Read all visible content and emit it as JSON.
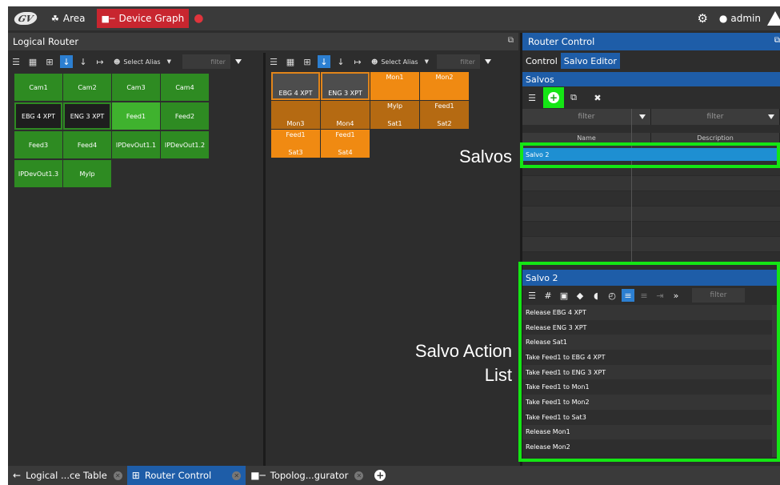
{
  "topbar": {
    "logo_icon": "gv-logo-icon",
    "area_label": "Area",
    "device_graph_label": "Device Graph",
    "user_label": "admin"
  },
  "logical_router": {
    "title": "Logical Router",
    "select_alias_label": "Select Alias",
    "filter_placeholder": "filter",
    "sources": [
      {
        "label": "Cam1",
        "style": "green"
      },
      {
        "label": "Cam2",
        "style": "green"
      },
      {
        "label": "Cam3",
        "style": "green"
      },
      {
        "label": "Cam4",
        "style": "green"
      },
      {
        "label": "EBG 4 XPT",
        "style": "dark"
      },
      {
        "label": "ENG 3 XPT",
        "style": "dark"
      },
      {
        "label": "Feed1",
        "style": "lgreen"
      },
      {
        "label": "Feed2",
        "style": "green"
      },
      {
        "label": "Feed3",
        "style": "green"
      },
      {
        "label": "Feed4",
        "style": "green"
      },
      {
        "label": "IPDevOut1.1",
        "style": "green"
      },
      {
        "label": "IPDevOut1.2",
        "style": "green"
      },
      {
        "label": "IPDevOut1.3",
        "style": "green"
      },
      {
        "label": "MyIp",
        "style": "green"
      }
    ],
    "destinations": [
      {
        "top": "",
        "bottom": "EBG 4 XPT",
        "style": "grey"
      },
      {
        "top": "",
        "bottom": "ENG 3 XPT",
        "style": "grey"
      },
      {
        "top": "Mon1",
        "bottom": "",
        "style": "orange"
      },
      {
        "top": "Mon2",
        "bottom": "",
        "style": "orange"
      },
      {
        "top": "",
        "bottom": "Mon3",
        "style": "dorange"
      },
      {
        "top": "",
        "bottom": "Mon4",
        "style": "dorange"
      },
      {
        "top": "MyIp",
        "bottom": "Sat1",
        "style": "dorange"
      },
      {
        "top": "Feed1",
        "bottom": "Sat2",
        "style": "dorange"
      },
      {
        "top": "Feed1",
        "bottom": "Sat3",
        "style": "orange"
      },
      {
        "top": "Feed1",
        "bottom": "Sat4",
        "style": "orange"
      }
    ]
  },
  "router_control": {
    "title": "Router Control",
    "tabs": [
      "Control",
      "Salvo Editor"
    ],
    "salvos_title": "Salvos",
    "filter_placeholder": "filter",
    "columns": [
      "Name",
      "Description"
    ],
    "salvos": [
      {
        "name": "Salvo 2",
        "description": ""
      }
    ],
    "salvo_detail_title": "Salvo 2",
    "actions": [
      "Release EBG 4 XPT",
      "Release ENG 3 XPT",
      "Release Sat1",
      "Take Feed1 to EBG 4 XPT",
      "Take Feed1 to ENG 3 XPT",
      "Take Feed1 to Mon1",
      "Take Feed1 to Mon2",
      "Take Feed1 to Sat3",
      "Release Mon1",
      "Release Mon2"
    ]
  },
  "callouts": {
    "salvos": "Salvos",
    "salvo_action_list_line1": "Salvo Action",
    "salvo_action_list_line2": "List"
  },
  "bottom_tabs": [
    {
      "label": "Logical ...ce Table",
      "icon": "back-arrow-icon",
      "active": false
    },
    {
      "label": "Router Control",
      "icon": "grid-icon",
      "active": true
    },
    {
      "label": "Topolog...gurator",
      "icon": "topology-icon",
      "active": false
    }
  ],
  "colors": {
    "accent_blue": "#1e5da8",
    "highlight_green": "#14e614",
    "active_red": "#c8262f",
    "source_green": "#2e8b22",
    "dest_orange": "#f08a12"
  }
}
